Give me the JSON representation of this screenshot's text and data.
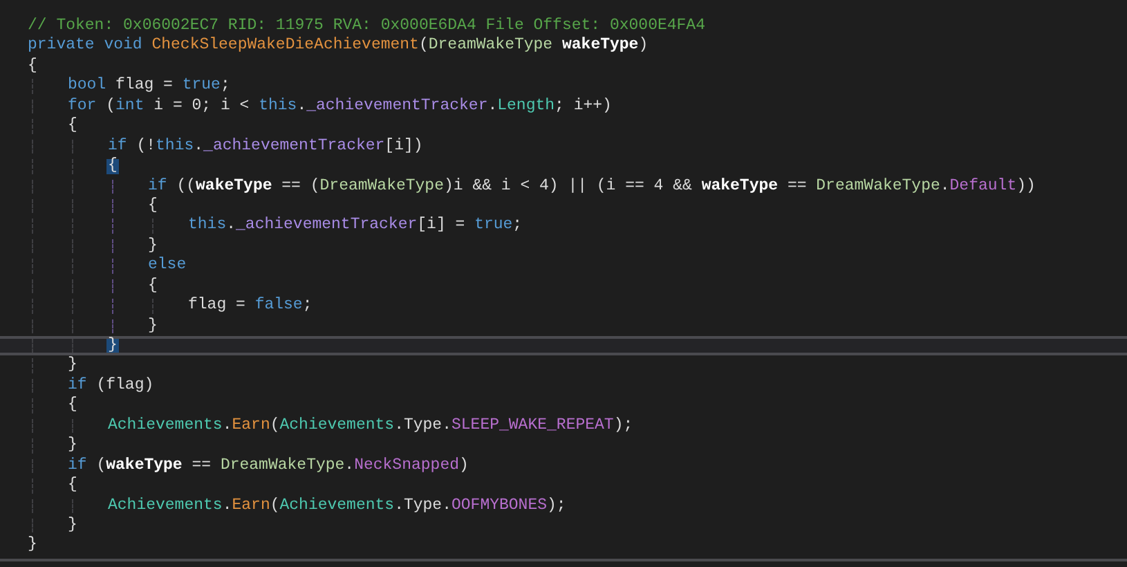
{
  "editor": {
    "lines": [
      {
        "current": false,
        "brace_match": false,
        "tokens": [
          {
            "kind": "comment",
            "text": "// Token: 0x06002EC7 RID: 11975 RVA: 0x000E6DA4 File Offset: 0x000E4FA4"
          }
        ]
      },
      {
        "current": false,
        "brace_match": false,
        "tokens": [
          {
            "kind": "keyword",
            "text": "private void "
          },
          {
            "kind": "method",
            "text": "CheckSleepWakeDieAchievement"
          },
          {
            "kind": "plain",
            "text": "("
          },
          {
            "kind": "enum",
            "text": "DreamWakeType "
          },
          {
            "kind": "param",
            "text": "wakeType"
          },
          {
            "kind": "plain",
            "text": ")"
          }
        ]
      },
      {
        "current": false,
        "brace_match": false,
        "tokens": [
          {
            "kind": "plain",
            "text": "{"
          }
        ],
        "children": [
          {
            "current": false,
            "brace_match": false,
            "tokens": [
              {
                "kind": "keyword",
                "text": "bool"
              },
              {
                "kind": "plain",
                "text": " flag = "
              },
              {
                "kind": "keyword",
                "text": "true"
              },
              {
                "kind": "plain",
                "text": ";"
              }
            ]
          },
          {
            "current": false,
            "brace_match": false,
            "tokens": [
              {
                "kind": "keyword",
                "text": "for"
              },
              {
                "kind": "plain",
                "text": " ("
              },
              {
                "kind": "keyword",
                "text": "int"
              },
              {
                "kind": "plain",
                "text": " i = 0; i < "
              },
              {
                "kind": "keyword",
                "text": "this"
              },
              {
                "kind": "plain",
                "text": "."
              },
              {
                "kind": "member",
                "text": "_achievementTracker"
              },
              {
                "kind": "plain",
                "text": "."
              },
              {
                "kind": "property",
                "text": "Length"
              },
              {
                "kind": "plain",
                "text": "; i++)"
              }
            ]
          },
          {
            "current": false,
            "brace_match": false,
            "tokens": [
              {
                "kind": "plain",
                "text": "{"
              }
            ],
            "children": [
              {
                "current": false,
                "brace_match": false,
                "tokens": [
                  {
                    "kind": "keyword",
                    "text": "if"
                  },
                  {
                    "kind": "plain",
                    "text": " (!"
                  },
                  {
                    "kind": "keyword",
                    "text": "this"
                  },
                  {
                    "kind": "plain",
                    "text": "."
                  },
                  {
                    "kind": "member",
                    "text": "_achievementTracker"
                  },
                  {
                    "kind": "plain",
                    "text": "[i])"
                  }
                ]
              },
              {
                "current": false,
                "brace_match": true,
                "tokens": [
                  {
                    "kind": "plain",
                    "text": "{"
                  }
                ],
                "children": [
                  {
                    "current": false,
                    "brace_match": false,
                    "tokens": [
                      {
                        "kind": "keyword",
                        "text": "if"
                      },
                      {
                        "kind": "plain",
                        "text": " (("
                      },
                      {
                        "kind": "param",
                        "text": "wakeType"
                      },
                      {
                        "kind": "plain",
                        "text": " == ("
                      },
                      {
                        "kind": "enum",
                        "text": "DreamWakeType"
                      },
                      {
                        "kind": "plain",
                        "text": ")i && i < 4) || (i == 4 && "
                      },
                      {
                        "kind": "param",
                        "text": "wakeType"
                      },
                      {
                        "kind": "plain",
                        "text": " == "
                      },
                      {
                        "kind": "enum",
                        "text": "DreamWakeType"
                      },
                      {
                        "kind": "plain",
                        "text": "."
                      },
                      {
                        "kind": "constant",
                        "text": "Default"
                      },
                      {
                        "kind": "plain",
                        "text": "))"
                      }
                    ]
                  },
                  {
                    "current": false,
                    "brace_match": false,
                    "tokens": [
                      {
                        "kind": "plain",
                        "text": "{"
                      }
                    ],
                    "children": [
                      {
                        "current": false,
                        "brace_match": false,
                        "tokens": [
                          {
                            "kind": "keyword",
                            "text": "this"
                          },
                          {
                            "kind": "plain",
                            "text": "."
                          },
                          {
                            "kind": "member",
                            "text": "_achievementTracker"
                          },
                          {
                            "kind": "plain",
                            "text": "[i] = "
                          },
                          {
                            "kind": "keyword",
                            "text": "true"
                          },
                          {
                            "kind": "plain",
                            "text": ";"
                          }
                        ]
                      }
                    ]
                  },
                  {
                    "current": false,
                    "brace_match": false,
                    "tokens": [
                      {
                        "kind": "plain",
                        "text": "}"
                      }
                    ]
                  },
                  {
                    "current": false,
                    "brace_match": false,
                    "tokens": [
                      {
                        "kind": "keyword",
                        "text": "else"
                      }
                    ]
                  },
                  {
                    "current": false,
                    "brace_match": false,
                    "tokens": [
                      {
                        "kind": "plain",
                        "text": "{"
                      }
                    ],
                    "children": [
                      {
                        "current": false,
                        "brace_match": false,
                        "tokens": [
                          {
                            "kind": "plain",
                            "text": "flag = "
                          },
                          {
                            "kind": "keyword",
                            "text": "false"
                          },
                          {
                            "kind": "plain",
                            "text": ";"
                          }
                        ]
                      }
                    ]
                  },
                  {
                    "current": false,
                    "brace_match": false,
                    "tokens": [
                      {
                        "kind": "plain",
                        "text": "}"
                      }
                    ]
                  }
                ]
              },
              {
                "current": true,
                "brace_match": true,
                "tokens": [
                  {
                    "kind": "plain",
                    "text": "}"
                  }
                ]
              }
            ]
          },
          {
            "current": false,
            "brace_match": false,
            "tokens": [
              {
                "kind": "plain",
                "text": "}"
              }
            ]
          },
          {
            "current": false,
            "brace_match": false,
            "tokens": [
              {
                "kind": "keyword",
                "text": "if"
              },
              {
                "kind": "plain",
                "text": " (flag)"
              }
            ]
          },
          {
            "current": false,
            "brace_match": false,
            "tokens": [
              {
                "kind": "plain",
                "text": "{"
              }
            ],
            "children": [
              {
                "current": false,
                "brace_match": false,
                "tokens": [
                  {
                    "kind": "class",
                    "text": "Achievements"
                  },
                  {
                    "kind": "plain",
                    "text": "."
                  },
                  {
                    "kind": "method",
                    "text": "Earn"
                  },
                  {
                    "kind": "plain",
                    "text": "("
                  },
                  {
                    "kind": "class",
                    "text": "Achievements"
                  },
                  {
                    "kind": "plain",
                    "text": ".Type."
                  },
                  {
                    "kind": "constant",
                    "text": "SLEEP_WAKE_REPEAT"
                  },
                  {
                    "kind": "plain",
                    "text": ");"
                  }
                ]
              }
            ]
          },
          {
            "current": false,
            "brace_match": false,
            "tokens": [
              {
                "kind": "plain",
                "text": "}"
              }
            ]
          },
          {
            "current": false,
            "brace_match": false,
            "tokens": [
              {
                "kind": "keyword",
                "text": "if"
              },
              {
                "kind": "plain",
                "text": " ("
              },
              {
                "kind": "param",
                "text": "wakeType"
              },
              {
                "kind": "plain",
                "text": " == "
              },
              {
                "kind": "enum",
                "text": "DreamWakeType"
              },
              {
                "kind": "plain",
                "text": "."
              },
              {
                "kind": "constant",
                "text": "NeckSnapped"
              },
              {
                "kind": "plain",
                "text": ")"
              }
            ]
          },
          {
            "current": false,
            "brace_match": false,
            "tokens": [
              {
                "kind": "plain",
                "text": "{"
              }
            ],
            "children": [
              {
                "current": false,
                "brace_match": false,
                "tokens": [
                  {
                    "kind": "class",
                    "text": "Achievements"
                  },
                  {
                    "kind": "plain",
                    "text": "."
                  },
                  {
                    "kind": "method",
                    "text": "Earn"
                  },
                  {
                    "kind": "plain",
                    "text": "("
                  },
                  {
                    "kind": "class",
                    "text": "Achievements"
                  },
                  {
                    "kind": "plain",
                    "text": ".Type."
                  },
                  {
                    "kind": "constant",
                    "text": "OOFMYBONES"
                  },
                  {
                    "kind": "plain",
                    "text": ");"
                  }
                ]
              }
            ]
          },
          {
            "current": false,
            "brace_match": false,
            "tokens": [
              {
                "kind": "plain",
                "text": "}"
              }
            ]
          }
        ]
      },
      {
        "current": false,
        "brace_match": false,
        "tokens": [
          {
            "kind": "plain",
            "text": "}"
          }
        ]
      }
    ]
  }
}
